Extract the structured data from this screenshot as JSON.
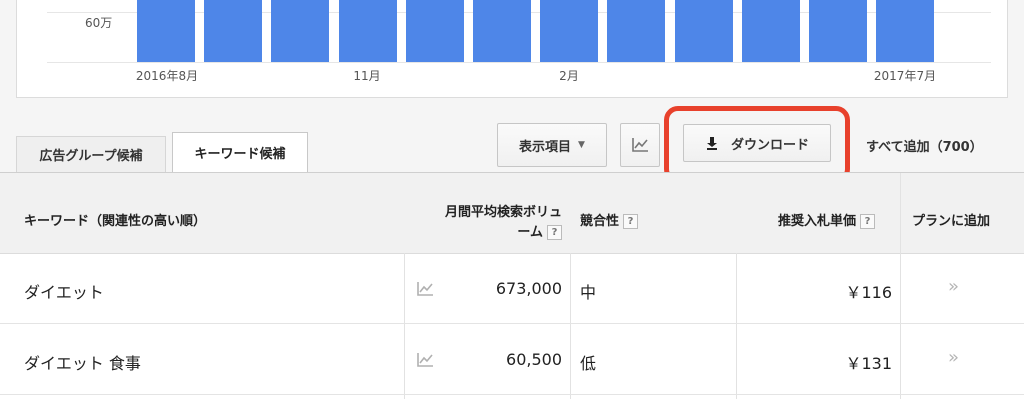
{
  "chart": {
    "y_tick": "60万",
    "x_ticks": [
      "2016年8月",
      "11月",
      "2月",
      "2017年7月"
    ],
    "bar_count": 12
  },
  "tabs": [
    {
      "label": "広告グループ候補"
    },
    {
      "label": "キーワード候補"
    }
  ],
  "toolbar": {
    "columns_label": "表示項目",
    "download_label": "ダウンロード",
    "add_all_label": "すべて追加（700）"
  },
  "table": {
    "headers": {
      "keyword": "キーワード（関連性の高い順）",
      "volume_line1": "月間平均検索ボリュ",
      "volume_line2": "ーム",
      "competition": "競合性",
      "bid": "推奨入札単価",
      "add": "プランに追加"
    },
    "help_mark": "?",
    "rows": [
      {
        "keyword": "ダイエット",
        "volume": "673,000",
        "competition": "中",
        "bid": "￥116",
        "action": "»"
      },
      {
        "keyword": "ダイエット 食事",
        "volume": "60,500",
        "competition": "低",
        "bid": "￥131",
        "action": "»"
      }
    ]
  },
  "colors": {
    "bar": "#4e86e8",
    "highlight": "#e8412c"
  }
}
